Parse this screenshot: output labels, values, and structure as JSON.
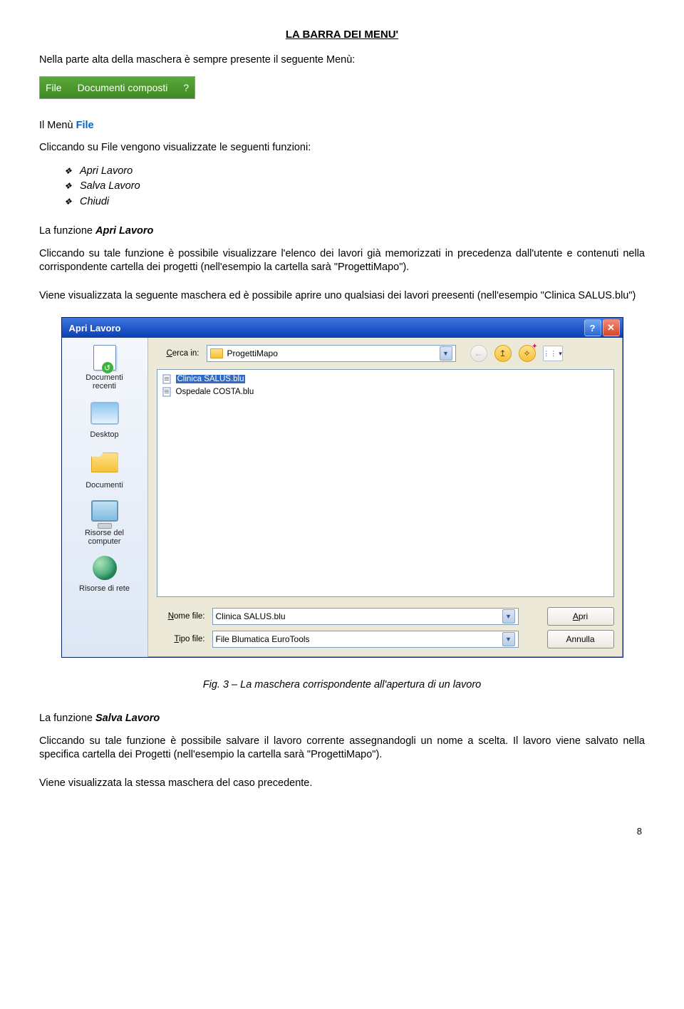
{
  "title": "LA BARRA DEI MENU'",
  "intro": "Nella parte alta della maschera è sempre presente il seguente Menù:",
  "menubar": {
    "file": "File",
    "docs": "Documenti composti",
    "help": "?"
  },
  "section1": {
    "heading_pre": "Il Menù  ",
    "heading_word": "File",
    "p1": "Cliccando su File vengono visualizzate le seguenti funzioni:",
    "bullets": [
      "Apri Lavoro",
      "Salva Lavoro",
      "Chiudi"
    ],
    "p2a": "La funzione ",
    "p2b": "Apri Lavoro",
    "p3": "Cliccando su tale funzione è possibile visualizzare l'elenco dei lavori già memorizzati in precedenza dall'utente e contenuti nella corrispondente cartella dei progetti (nell'esempio la cartella sarà \"ProgettiMapo\").",
    "p4": "Viene visualizzata la seguente maschera ed è possibile aprire uno qualsiasi dei lavori preesenti (nell'esempio \"Clinica SALUS.blu\")"
  },
  "dialog": {
    "title": "Apri Lavoro",
    "look_label": "Cerca in:",
    "look_value": "ProgettiMapo",
    "places": {
      "recent": "Documenti\nrecenti",
      "desktop": "Desktop",
      "docs": "Documenti",
      "computer": "Risorse del\ncomputer",
      "network": "Risorse di rete"
    },
    "files": {
      "f1": "Clinica SALUS.blu",
      "f2": "Ospedale COSTA.blu"
    },
    "labels": {
      "name": "Nome file:",
      "type": "Tipo file:"
    },
    "values": {
      "name": "Clinica SALUS.blu",
      "type": "File Blumatica EuroTools"
    },
    "buttons": {
      "open": "Apri",
      "cancel": "Annulla"
    }
  },
  "fig_caption": "Fig. 3 – La maschera corrispondente all'apertura di un lavoro",
  "section2": {
    "p1a": "La funzione ",
    "p1b": "Salva Lavoro",
    "p2": "Cliccando su tale funzione è possibile salvare il lavoro corrente assegnandogli un nome a scelta. Il lavoro viene salvato nella specifica cartella dei Progetti (nell'esempio la cartella sarà \"ProgettiMapo\").",
    "p3": "Viene visualizzata la stessa maschera del caso precedente."
  },
  "page_num": "8"
}
